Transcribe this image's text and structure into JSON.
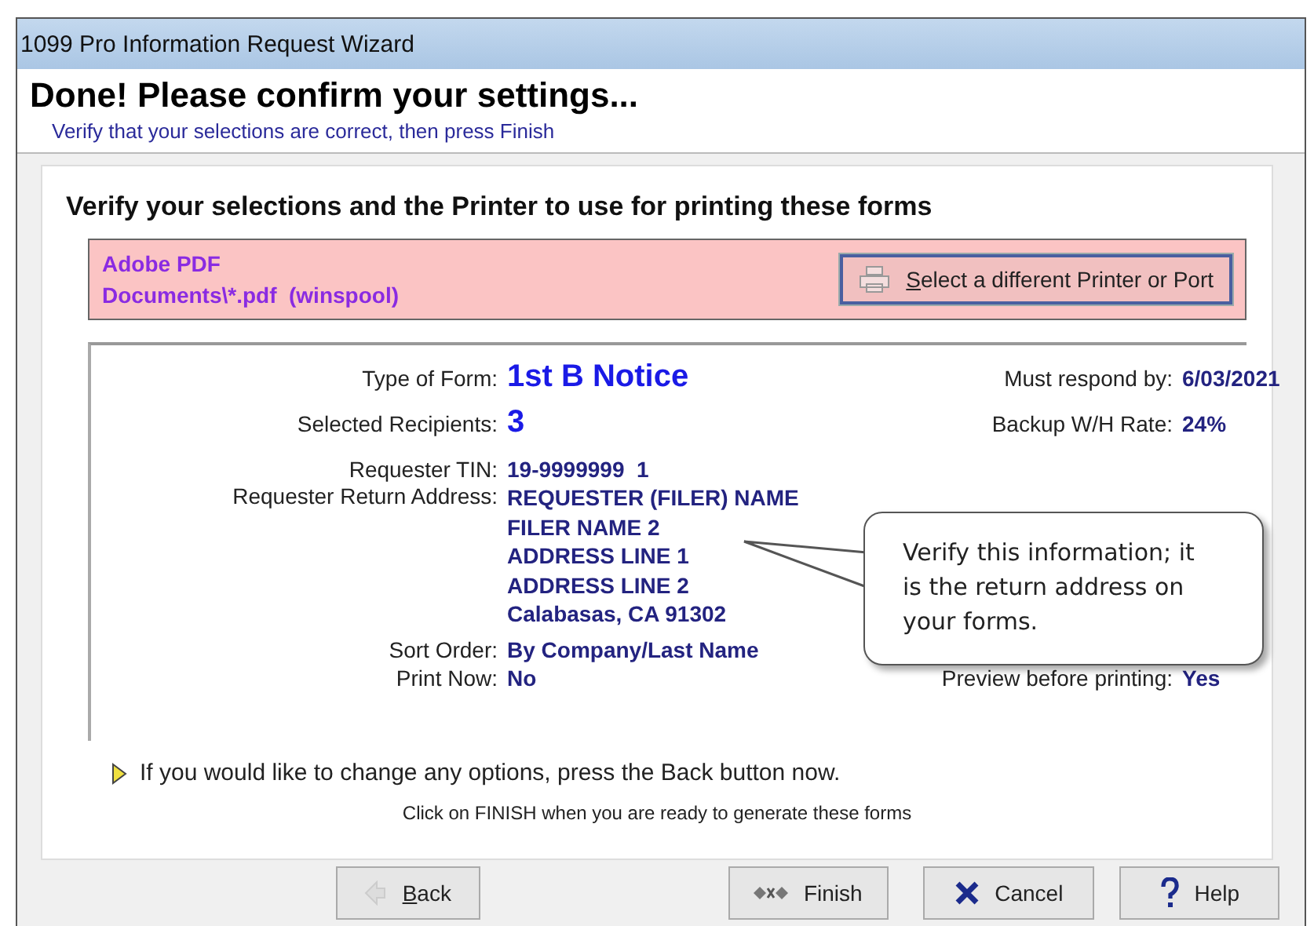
{
  "window": {
    "title": "1099 Pro Information Request Wizard"
  },
  "header": {
    "title": "Done!  Please confirm your settings...",
    "subtitle": "Verify that your selections are correct, then press Finish"
  },
  "section_title": "Verify your selections and the Printer to use for printing these forms",
  "printer": {
    "name": "Adobe PDF",
    "port": "Documents\\*.pdf  (winspool)",
    "button": {
      "label": "Select a different Printer or Port",
      "accelerator": true
    }
  },
  "summary": {
    "type_of_form": {
      "label": "Type of Form:",
      "value": "1st B Notice"
    },
    "must_respond_by": {
      "label": "Must respond by:",
      "value": "6/03/2021"
    },
    "selected_recipients": {
      "label": "Selected Recipients:",
      "value": "3"
    },
    "backup_rate": {
      "label": "Backup W/H Rate:",
      "value": "24%"
    },
    "requester_tin": {
      "label": "Requester TIN:",
      "value": "19-9999999  1"
    },
    "return_address": {
      "label": "Requester Return Address:",
      "lines": [
        "REQUESTER (FILER) NAME",
        "FILER NAME 2",
        "ADDRESS LINE 1",
        "ADDRESS LINE 2",
        "Calabasas, CA 91302"
      ]
    },
    "sort_order": {
      "label": "Sort Order:",
      "value": "By Company/Last Name"
    },
    "print_now": {
      "label": "Print Now:",
      "value": "No"
    },
    "preview": {
      "label": "Preview before printing:",
      "value": "Yes"
    }
  },
  "callout": "Verify this information; it is the return address on your forms.",
  "hint": "If you would like to change any options, press the Back button now.",
  "instruction": "Click on FINISH when you are ready to generate these forms",
  "buttons": [
    {
      "kind": "back",
      "label": "Back",
      "accelerator": true,
      "disabled": false
    },
    {
      "kind": "finish",
      "label": "Finish",
      "accelerator": false,
      "disabled": false
    },
    {
      "kind": "cancel",
      "label": "Cancel",
      "accelerator": false,
      "disabled": false
    },
    {
      "kind": "help",
      "label": "Help",
      "accelerator": false,
      "disabled": false
    }
  ]
}
